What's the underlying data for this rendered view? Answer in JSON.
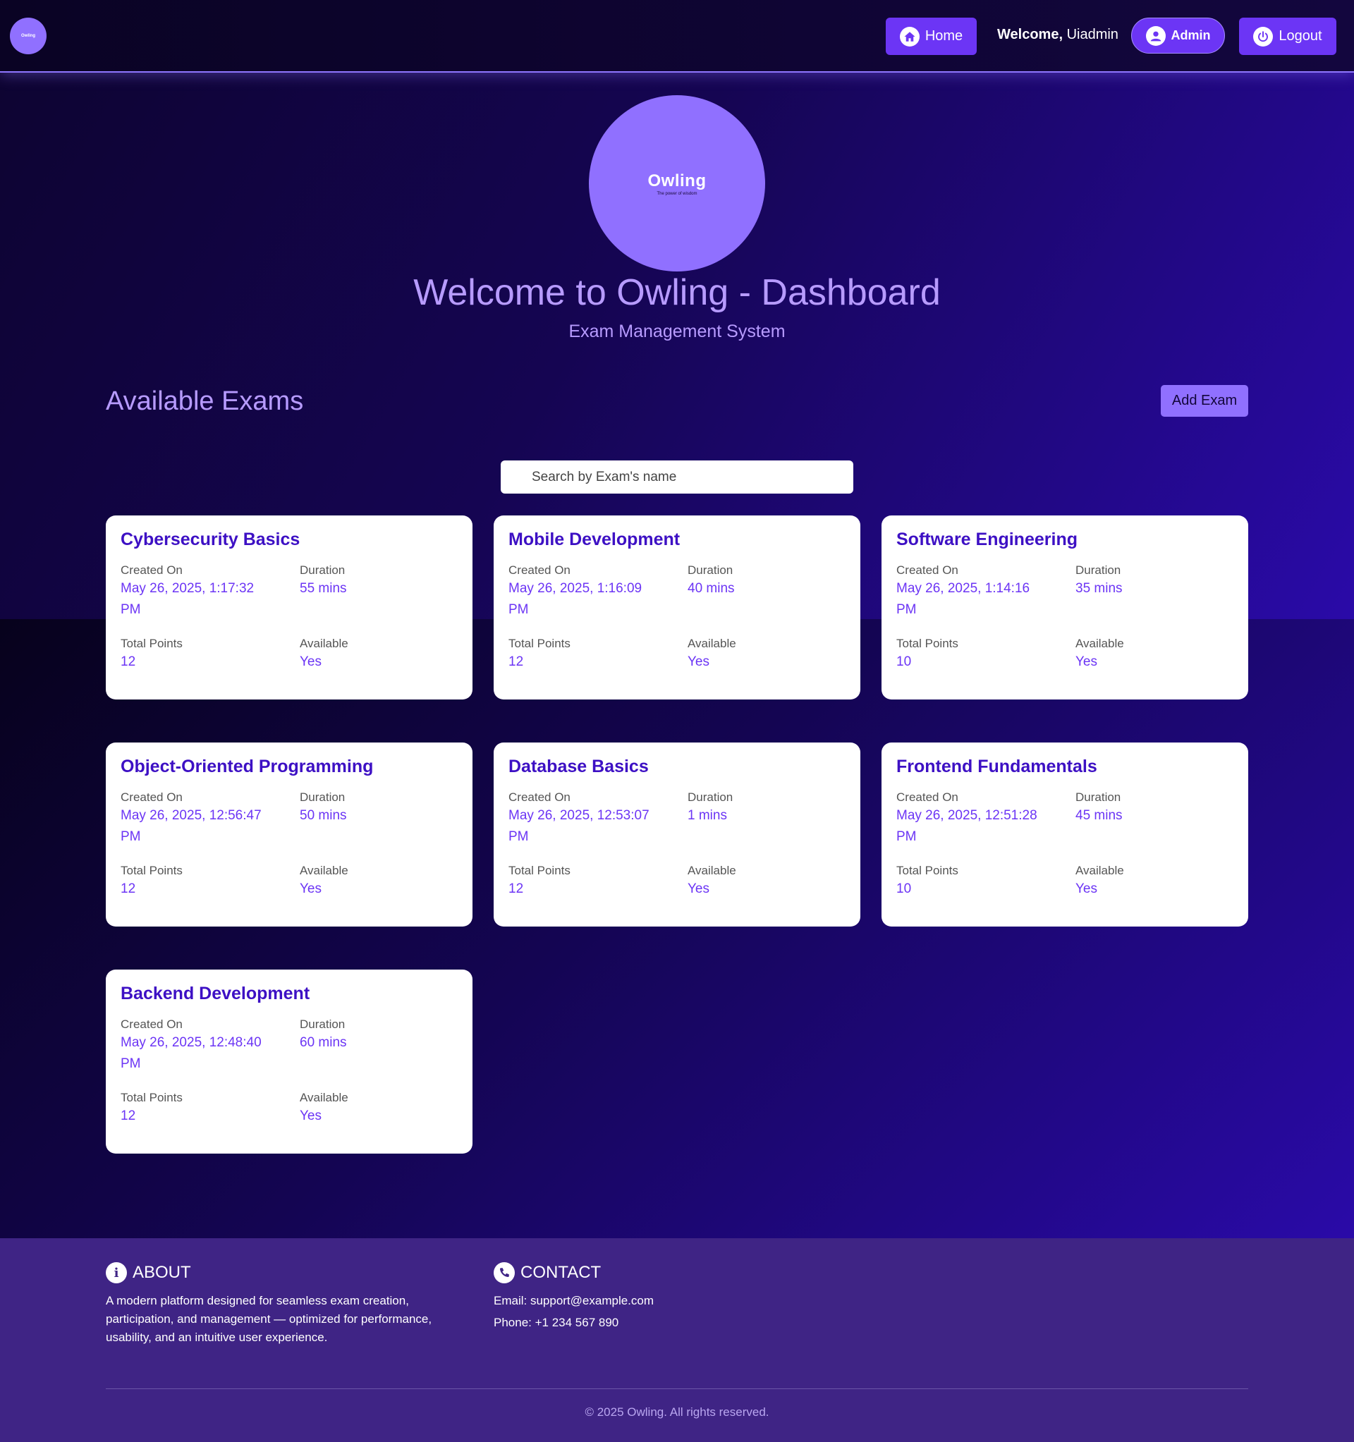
{
  "header": {
    "logo_text": "Owling",
    "home_label": "Home",
    "welcome_prefix": "Welcome,",
    "username": "Uiadmin",
    "admin_label": "Admin",
    "logout_label": "Logout"
  },
  "hero": {
    "logo_brand": "Owling",
    "logo_tagline": "The power of wisdom",
    "title": "Welcome to Owling - Dashboard",
    "subtitle": "Exam Management System"
  },
  "exams_section": {
    "title": "Available Exams",
    "add_button": "Add Exam",
    "search_placeholder": "Search by Exam's name",
    "labels": {
      "created_on": "Created On",
      "duration": "Duration",
      "total_points": "Total Points",
      "available": "Available"
    },
    "exams": [
      {
        "name": "Cybersecurity Basics",
        "created_on": "May 26, 2025, 1:17:32 PM",
        "duration": "55 mins",
        "total_points": "12",
        "available": "Yes"
      },
      {
        "name": "Mobile Development",
        "created_on": "May 26, 2025, 1:16:09 PM",
        "duration": "40 mins",
        "total_points": "12",
        "available": "Yes"
      },
      {
        "name": "Software Engineering",
        "created_on": "May 26, 2025, 1:14:16 PM",
        "duration": "35 mins",
        "total_points": "10",
        "available": "Yes"
      },
      {
        "name": "Object-Oriented Programming",
        "created_on": "May 26, 2025, 12:56:47 PM",
        "duration": "50 mins",
        "total_points": "12",
        "available": "Yes"
      },
      {
        "name": "Database Basics",
        "created_on": "May 26, 2025, 12:53:07 PM",
        "duration": "1 mins",
        "total_points": "12",
        "available": "Yes"
      },
      {
        "name": "Frontend Fundamentals",
        "created_on": "May 26, 2025, 12:51:28 PM",
        "duration": "45 mins",
        "total_points": "10",
        "available": "Yes"
      },
      {
        "name": "Backend Development",
        "created_on": "May 26, 2025, 12:48:40 PM",
        "duration": "60 mins",
        "total_points": "12",
        "available": "Yes"
      }
    ]
  },
  "footer": {
    "about_title": "ABOUT",
    "about_text": "A modern platform designed for seamless exam creation, participation, and management — optimized for performance, usability, and an intuitive user experience.",
    "contact_title": "CONTACT",
    "email": "Email: support@example.com",
    "phone": "Phone: +1 234 567 890",
    "copyright": "© 2025 Owling. All rights reserved."
  },
  "colors": {
    "accent": "#6c35f5",
    "accent_light": "#9070ff",
    "title_text": "#b79bff",
    "card_title": "#3d10c4",
    "footer_bg": "#3f2485"
  },
  "icons": {
    "home": "home-icon",
    "admin": "user-icon",
    "logout": "power-icon",
    "about": "info-icon",
    "contact": "phone-icon"
  }
}
